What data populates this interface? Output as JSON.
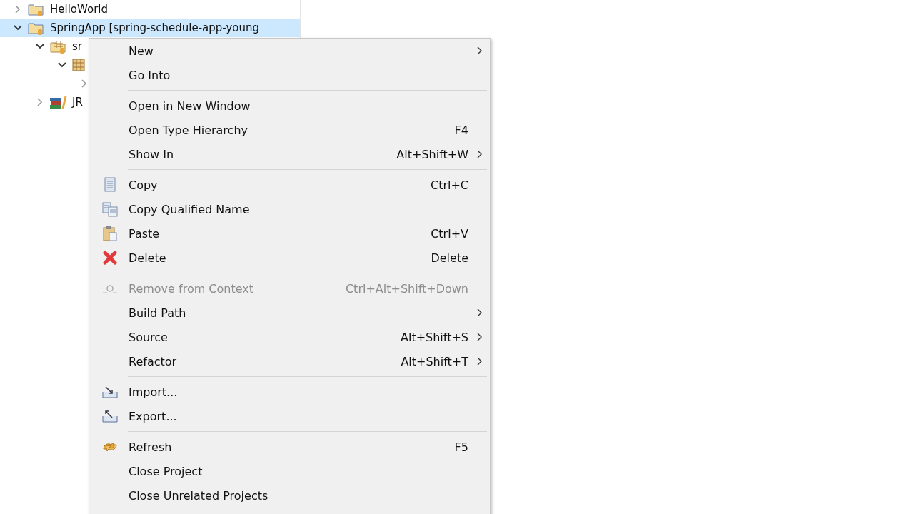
{
  "tree": [
    {
      "label": "HelloWorld",
      "kind": "project",
      "expanded": false,
      "selected": false
    },
    {
      "label": "SpringApp [spring-schedule-app-young",
      "kind": "project",
      "expanded": true,
      "selected": true,
      "children": [
        {
          "label": "sr",
          "kind": "source-folder",
          "expanded": true,
          "selected": false,
          "children": [
            {
              "kind": "package",
              "expanded": true,
              "selected": false,
              "children": [
                {
                  "expanded": false,
                  "selected": false
                }
              ]
            }
          ]
        },
        {
          "label": "JR",
          "kind": "library",
          "expanded": false,
          "selected": false
        }
      ]
    }
  ],
  "context_menu": [
    {
      "kind": "item",
      "label": "New",
      "submenu": true,
      "disabled": false
    },
    {
      "kind": "item",
      "label": "Go Into",
      "submenu": false,
      "disabled": false
    },
    {
      "kind": "separator"
    },
    {
      "kind": "item",
      "label": "Open in New Window",
      "submenu": false,
      "disabled": false
    },
    {
      "kind": "item",
      "label": "Open Type Hierarchy",
      "shortcut": "F4",
      "submenu": false,
      "disabled": false
    },
    {
      "kind": "item",
      "label": "Show In",
      "shortcut": "Alt+Shift+W",
      "submenu": true,
      "disabled": false
    },
    {
      "kind": "separator"
    },
    {
      "kind": "copy",
      "label": "Copy",
      "shortcut": "Ctrl+C",
      "submenu": false,
      "disabled": false
    },
    {
      "kind": "copy-qualified",
      "label": "Copy Qualified Name",
      "submenu": false,
      "disabled": false
    },
    {
      "kind": "paste",
      "label": "Paste",
      "shortcut": "Ctrl+V",
      "submenu": false,
      "disabled": false
    },
    {
      "kind": "delete",
      "label": "Delete",
      "shortcut": "Delete",
      "submenu": false,
      "disabled": false
    },
    {
      "kind": "separator"
    },
    {
      "kind": "remove-context",
      "label": "Remove from Context",
      "shortcut": "Ctrl+Alt+Shift+Down",
      "submenu": false,
      "disabled": true
    },
    {
      "kind": "item",
      "label": "Build Path",
      "submenu": true,
      "disabled": false
    },
    {
      "kind": "item",
      "label": "Source",
      "shortcut": "Alt+Shift+S",
      "submenu": true,
      "disabled": false
    },
    {
      "kind": "item",
      "label": "Refactor",
      "shortcut": "Alt+Shift+T",
      "submenu": true,
      "disabled": false
    },
    {
      "kind": "separator"
    },
    {
      "kind": "import",
      "label": "Import...",
      "submenu": false,
      "disabled": false
    },
    {
      "kind": "export",
      "label": "Export...",
      "submenu": false,
      "disabled": false
    },
    {
      "kind": "separator"
    },
    {
      "kind": "refresh",
      "label": "Refresh",
      "shortcut": "F5",
      "submenu": false,
      "disabled": false
    },
    {
      "kind": "item",
      "label": "Close Project",
      "submenu": false,
      "disabled": false
    },
    {
      "kind": "item",
      "label": "Close Unrelated Projects",
      "submenu": false,
      "disabled": false
    }
  ]
}
